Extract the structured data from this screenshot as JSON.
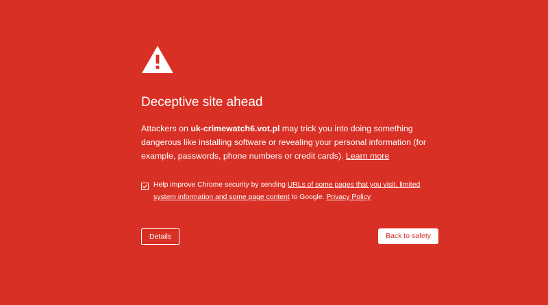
{
  "icon": "warning-triangle-icon",
  "title": "Deceptive site ahead",
  "body": {
    "prefix": "Attackers on ",
    "domain": "uk-crimewatch6.vot.pl",
    "suffix": " may trick you into doing something dangerous like installing software or revealing your personal information (for example, passwords, phone numbers or credit cards). ",
    "learn_more": "Learn more"
  },
  "optin": {
    "checked": true,
    "prefix": "Help improve Chrome security by sending ",
    "link": "URLs of some pages that you visit, limited system information and some page content",
    "middle": " to Google. ",
    "privacy_policy": "Privacy Policy"
  },
  "buttons": {
    "details": "Details",
    "back_to_safety": "Back to safety"
  },
  "colors": {
    "background": "#d93025",
    "foreground": "#ffffff"
  }
}
